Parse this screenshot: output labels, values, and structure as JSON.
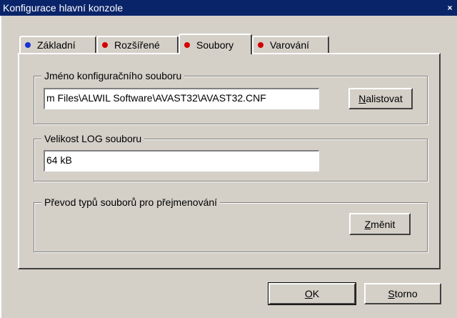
{
  "window": {
    "title": "Konfigurace hlavní konzole",
    "close_glyph": "×"
  },
  "tabs": [
    {
      "label": "Základní",
      "dot": "blue",
      "active": false
    },
    {
      "label": "Rozšířené",
      "dot": "red",
      "active": false
    },
    {
      "label": "Soubory",
      "dot": "red",
      "active": true
    },
    {
      "label": "Varování",
      "dot": "red",
      "active": false
    }
  ],
  "config_file": {
    "label": "Jméno konfiguračního souboru",
    "value": "m Files\\ALWIL Software\\AVAST32\\AVAST32.CNF",
    "browse_button": {
      "first": "N",
      "rest": "alistovat"
    }
  },
  "log_size": {
    "label": "Velikost LOG souboru",
    "value": "64   kB"
  },
  "rename": {
    "label": "Převod typů souborů pro přejmenování",
    "change_button": {
      "first": "Z",
      "rest": "měnit"
    }
  },
  "footer": {
    "ok_button": {
      "first": "O",
      "rest": "K"
    },
    "cancel_button": {
      "first": "S",
      "rest": "torno"
    }
  },
  "colors": {
    "titlebar": "#0a246a",
    "face": "#d4d0c8",
    "dot_blue": "#1a2fd8",
    "dot_red": "#d40000"
  }
}
